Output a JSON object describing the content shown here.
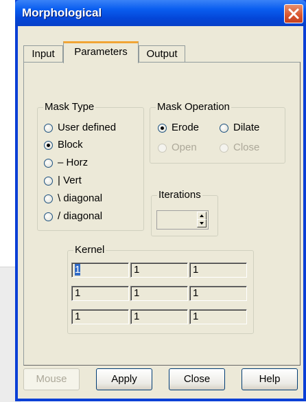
{
  "window": {
    "title": "Morphological"
  },
  "tabs": [
    "Input",
    "Parameters",
    "Output"
  ],
  "active_tab": "Parameters",
  "mask_type": {
    "label": "Mask Type",
    "options": [
      "User defined",
      "Block",
      "– Horz",
      "| Vert",
      "\\ diagonal",
      "/ diagonal"
    ],
    "selected": "Block"
  },
  "mask_operation": {
    "label": "Mask Operation",
    "options": [
      "Erode",
      "Dilate",
      "Open",
      "Close"
    ],
    "selected": "Erode",
    "disabled": [
      "Open",
      "Close"
    ]
  },
  "iterations": {
    "label": "Iterations",
    "value": ""
  },
  "kernel": {
    "label": "Kernel",
    "rows": [
      [
        "1",
        "1",
        "1"
      ],
      [
        "1",
        "1",
        "1"
      ],
      [
        "1",
        "1",
        "1"
      ]
    ]
  },
  "buttons": {
    "mouse": "Mouse",
    "apply": "Apply",
    "close": "Close",
    "help": "Help"
  },
  "colors": {
    "titlebar": "#0a5ef0",
    "face": "#ece9d8",
    "close_button": "#d8542c",
    "selection": "#316ac5"
  }
}
